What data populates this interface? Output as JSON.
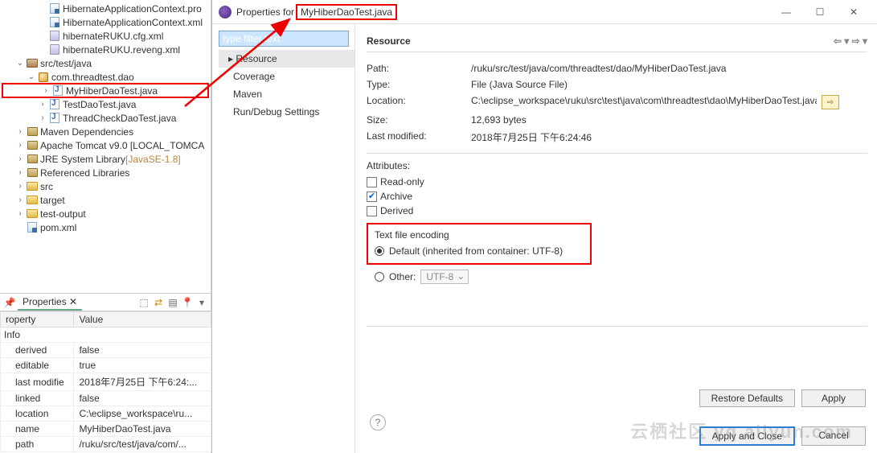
{
  "tree": {
    "items": [
      {
        "indent": 46,
        "icon": "ico-xml",
        "label": "HibernateApplicationContext.pro"
      },
      {
        "indent": 46,
        "icon": "ico-xml",
        "label": "HibernateApplicationContext.xml"
      },
      {
        "indent": 46,
        "icon": "ico-file",
        "label": "hibernateRUKU.cfg.xml"
      },
      {
        "indent": 46,
        "icon": "ico-file",
        "label": "hibernateRUKU.reveng.xml"
      },
      {
        "indent": 18,
        "tw": "⌄",
        "icon": "ico-folder br",
        "label": "src/test/java"
      },
      {
        "indent": 32,
        "tw": "⌄",
        "icon": "ico-pkg",
        "label": "com.threadtest.dao"
      },
      {
        "indent": 46,
        "tw": "›",
        "icon": "ico-j",
        "label": "MyHiberDaoTest.java",
        "selected": true
      },
      {
        "indent": 46,
        "tw": "›",
        "icon": "ico-j",
        "label": "TestDaoTest.java"
      },
      {
        "indent": 46,
        "tw": "›",
        "icon": "ico-j",
        "label": "ThreadCheckDaoTest.java"
      },
      {
        "indent": 18,
        "tw": "›",
        "icon": "ico-lib",
        "label": "Maven Dependencies"
      },
      {
        "indent": 18,
        "tw": "›",
        "icon": "ico-lib",
        "label": "Apache Tomcat v9.0 [LOCAL_TOMCA"
      },
      {
        "indent": 18,
        "tw": "›",
        "icon": "ico-lib",
        "label": "JRE System Library",
        "suffix": "[JavaSE-1.8]"
      },
      {
        "indent": 18,
        "tw": "›",
        "icon": "ico-lib",
        "label": "Referenced Libraries"
      },
      {
        "indent": 18,
        "tw": "›",
        "icon": "ico-folder",
        "label": "src"
      },
      {
        "indent": 18,
        "tw": "›",
        "icon": "ico-folder",
        "label": "target"
      },
      {
        "indent": 18,
        "tw": "›",
        "icon": "ico-folder",
        "label": "test-output"
      },
      {
        "indent": 18,
        "tw": "",
        "icon": "ico-xml",
        "label": "pom.xml"
      }
    ]
  },
  "propsview": {
    "title": "Properties",
    "col1": "roperty",
    "col2": "Value",
    "group": "Info",
    "rows": [
      {
        "k": "derived",
        "v": "false"
      },
      {
        "k": "editable",
        "v": "true"
      },
      {
        "k": "last modifie",
        "v": "2018年7月25日 下午6:24:..."
      },
      {
        "k": "linked",
        "v": "false"
      },
      {
        "k": "location",
        "v": "C:\\eclipse_workspace\\ru..."
      },
      {
        "k": "name",
        "v": "MyHiberDaoTest.java"
      },
      {
        "k": "path",
        "v": "/ruku/src/test/java/com/..."
      }
    ]
  },
  "dialog": {
    "title_prefix": "Properties for",
    "title_file": "MyHiberDaoTest.java",
    "filter_text": "type filter text",
    "nav": [
      "Resource",
      "Coverage",
      "Maven",
      "Run/Debug Settings"
    ],
    "section": "Resource",
    "fields": {
      "path_l": "Path:",
      "path_v": "/ruku/src/test/java/com/threadtest/dao/MyHiberDaoTest.java",
      "type_l": "Type:",
      "type_v": "File  (Java Source File)",
      "loc_l": "Location:",
      "loc_v": "C:\\eclipse_workspace\\ruku\\src\\test\\java\\com\\threadtest\\dao\\MyHiberDaoTest.java",
      "size_l": "Size:",
      "size_v": "12,693  bytes",
      "mod_l": "Last modified:",
      "mod_v": "2018年7月25日 下午6:24:46"
    },
    "attr_label": "Attributes:",
    "attrs": {
      "readonly": "Read-only",
      "archive": "Archive",
      "derived": "Derived"
    },
    "encoding": {
      "group": "Text file encoding",
      "default": "Default (inherited from container: UTF-8)",
      "other": "Other:",
      "other_val": "UTF-8"
    },
    "buttons": {
      "restore": "Restore Defaults",
      "apply": "Apply",
      "applyclose": "Apply and Close",
      "cancel": "Cancel"
    }
  },
  "watermark": "云栖社区 yq.aliyun.com"
}
